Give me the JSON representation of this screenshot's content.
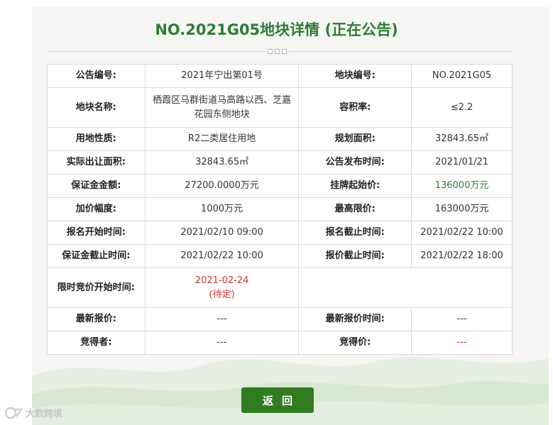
{
  "title": "NO.2021G05地块详情 (正在公告)",
  "rows": [
    {
      "l1": "公告编号:",
      "v1": "2021年宁出第01号",
      "l2": "地块编号:",
      "v2": "NO.2021G05"
    },
    {
      "l1": "地块名称:",
      "v1": "栖霞区马群街道马高路以西、芝嘉花园东侧地块",
      "l2": "容积率:",
      "v2": "≤2.2"
    },
    {
      "l1": "用地性质:",
      "v1": "R2二类居住用地",
      "l2": "规划面积:",
      "v2": "32843.65㎡"
    },
    {
      "l1": "实际出让面积:",
      "v1": "32843.65㎡",
      "l2": "公告发布时间:",
      "v2": "2021/01/21"
    },
    {
      "l1": "保证金金额:",
      "v1": "27200.0000万元",
      "l2": "挂牌起始价:",
      "v2": "136000万元"
    },
    {
      "l1": "加价幅度:",
      "v1": "1000万元",
      "l2": "最高限价:",
      "v2": "163000万元"
    },
    {
      "l1": "报名开始时间:",
      "v1": "2021/02/10 09:00",
      "l2": "报名截止时间:",
      "v2": "2021/02/22 10:00"
    },
    {
      "l1": "保证金截止时间:",
      "v1": "2021/02/22 10:00",
      "l2": "报价截止时间:",
      "v2": "2021/02/22 18:00"
    }
  ],
  "auction": {
    "label": "限时竞价开始时间:",
    "date": "2021-02-24",
    "note": "(待定)"
  },
  "latest": {
    "l1": "最新报价:",
    "v1": "---",
    "l2": "最新报价时间:",
    "v2": "---"
  },
  "winner": {
    "l1": "竞得者:",
    "v1": "---",
    "l2": "竞得价:",
    "v2": "---"
  },
  "back_label": "返回",
  "watermark": "大数跨境",
  "colors": {
    "title": "#2e7d32",
    "button": "#2f7d1f",
    "highlight_green": "#2e7d32",
    "highlight_red": "#d32f2f"
  }
}
